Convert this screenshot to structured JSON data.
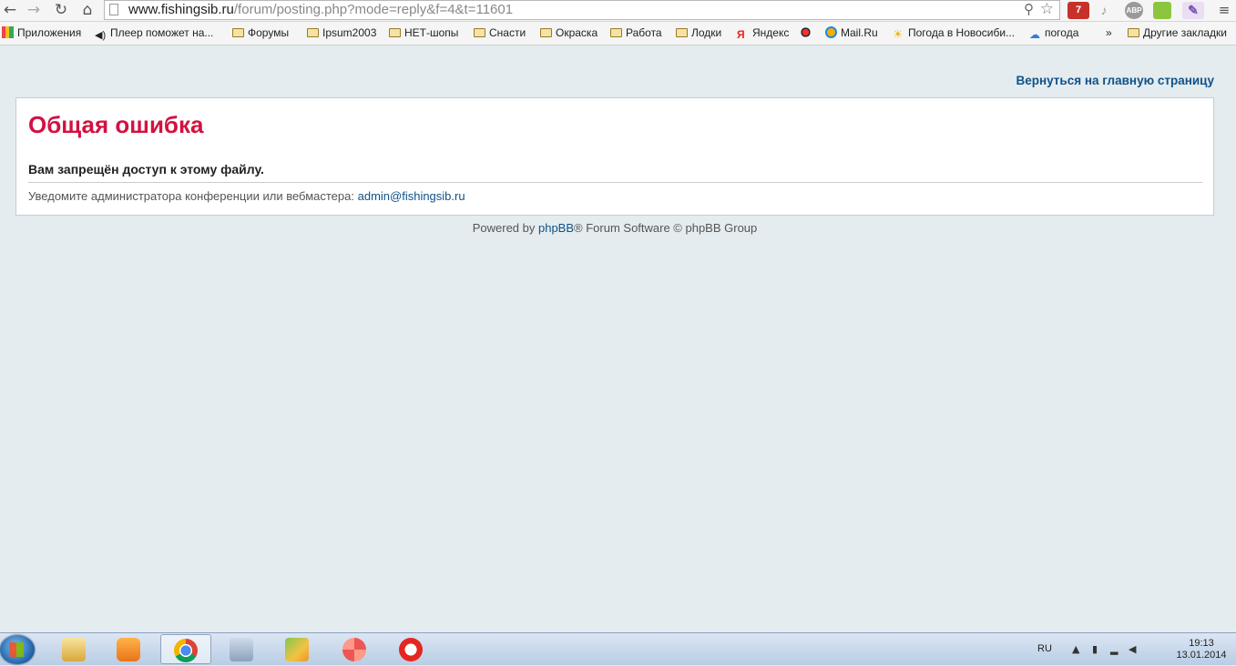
{
  "browser": {
    "url_host": "www.fishingsib.ru",
    "url_path": "/forum/posting.php?mode=reply&f=4&t=11601",
    "extensions": {
      "gmail_count": "7",
      "abp_label": "ABP"
    }
  },
  "bookmarks": {
    "items": [
      {
        "label": "Приложения"
      },
      {
        "label": "Плеер поможет на..."
      },
      {
        "label": "Форумы"
      },
      {
        "label": "Ipsum2003"
      },
      {
        "label": "НЕТ-шопы"
      },
      {
        "label": "Снасти"
      },
      {
        "label": "Окраска"
      },
      {
        "label": "Работа"
      },
      {
        "label": "Лодки"
      },
      {
        "label": "Яндекс"
      },
      {
        "label": ""
      },
      {
        "label": "Mail.Ru"
      },
      {
        "label": "Погода в Новосиби..."
      },
      {
        "label": "погода"
      }
    ],
    "overflow": "»",
    "other": "Другие закладки"
  },
  "page": {
    "back_link": "Вернуться на главную страницу",
    "error_title": "Общая ошибка",
    "error_message": "Вам запрещён доступ к этому файлу.",
    "notify_text": "Уведомите администратора конференции или вебмастера: ",
    "notify_email": "admin@fishingsib.ru",
    "footer_prefix": "Powered by ",
    "footer_link": "phpBB",
    "footer_suffix": "® Forum Software © phpBB Group"
  },
  "taskbar": {
    "language": "RU",
    "time": "19:13",
    "date": "13.01.2014"
  },
  "colors": {
    "error_title": "#d31141",
    "link": "#105289",
    "page_background": "#e4ecef"
  }
}
